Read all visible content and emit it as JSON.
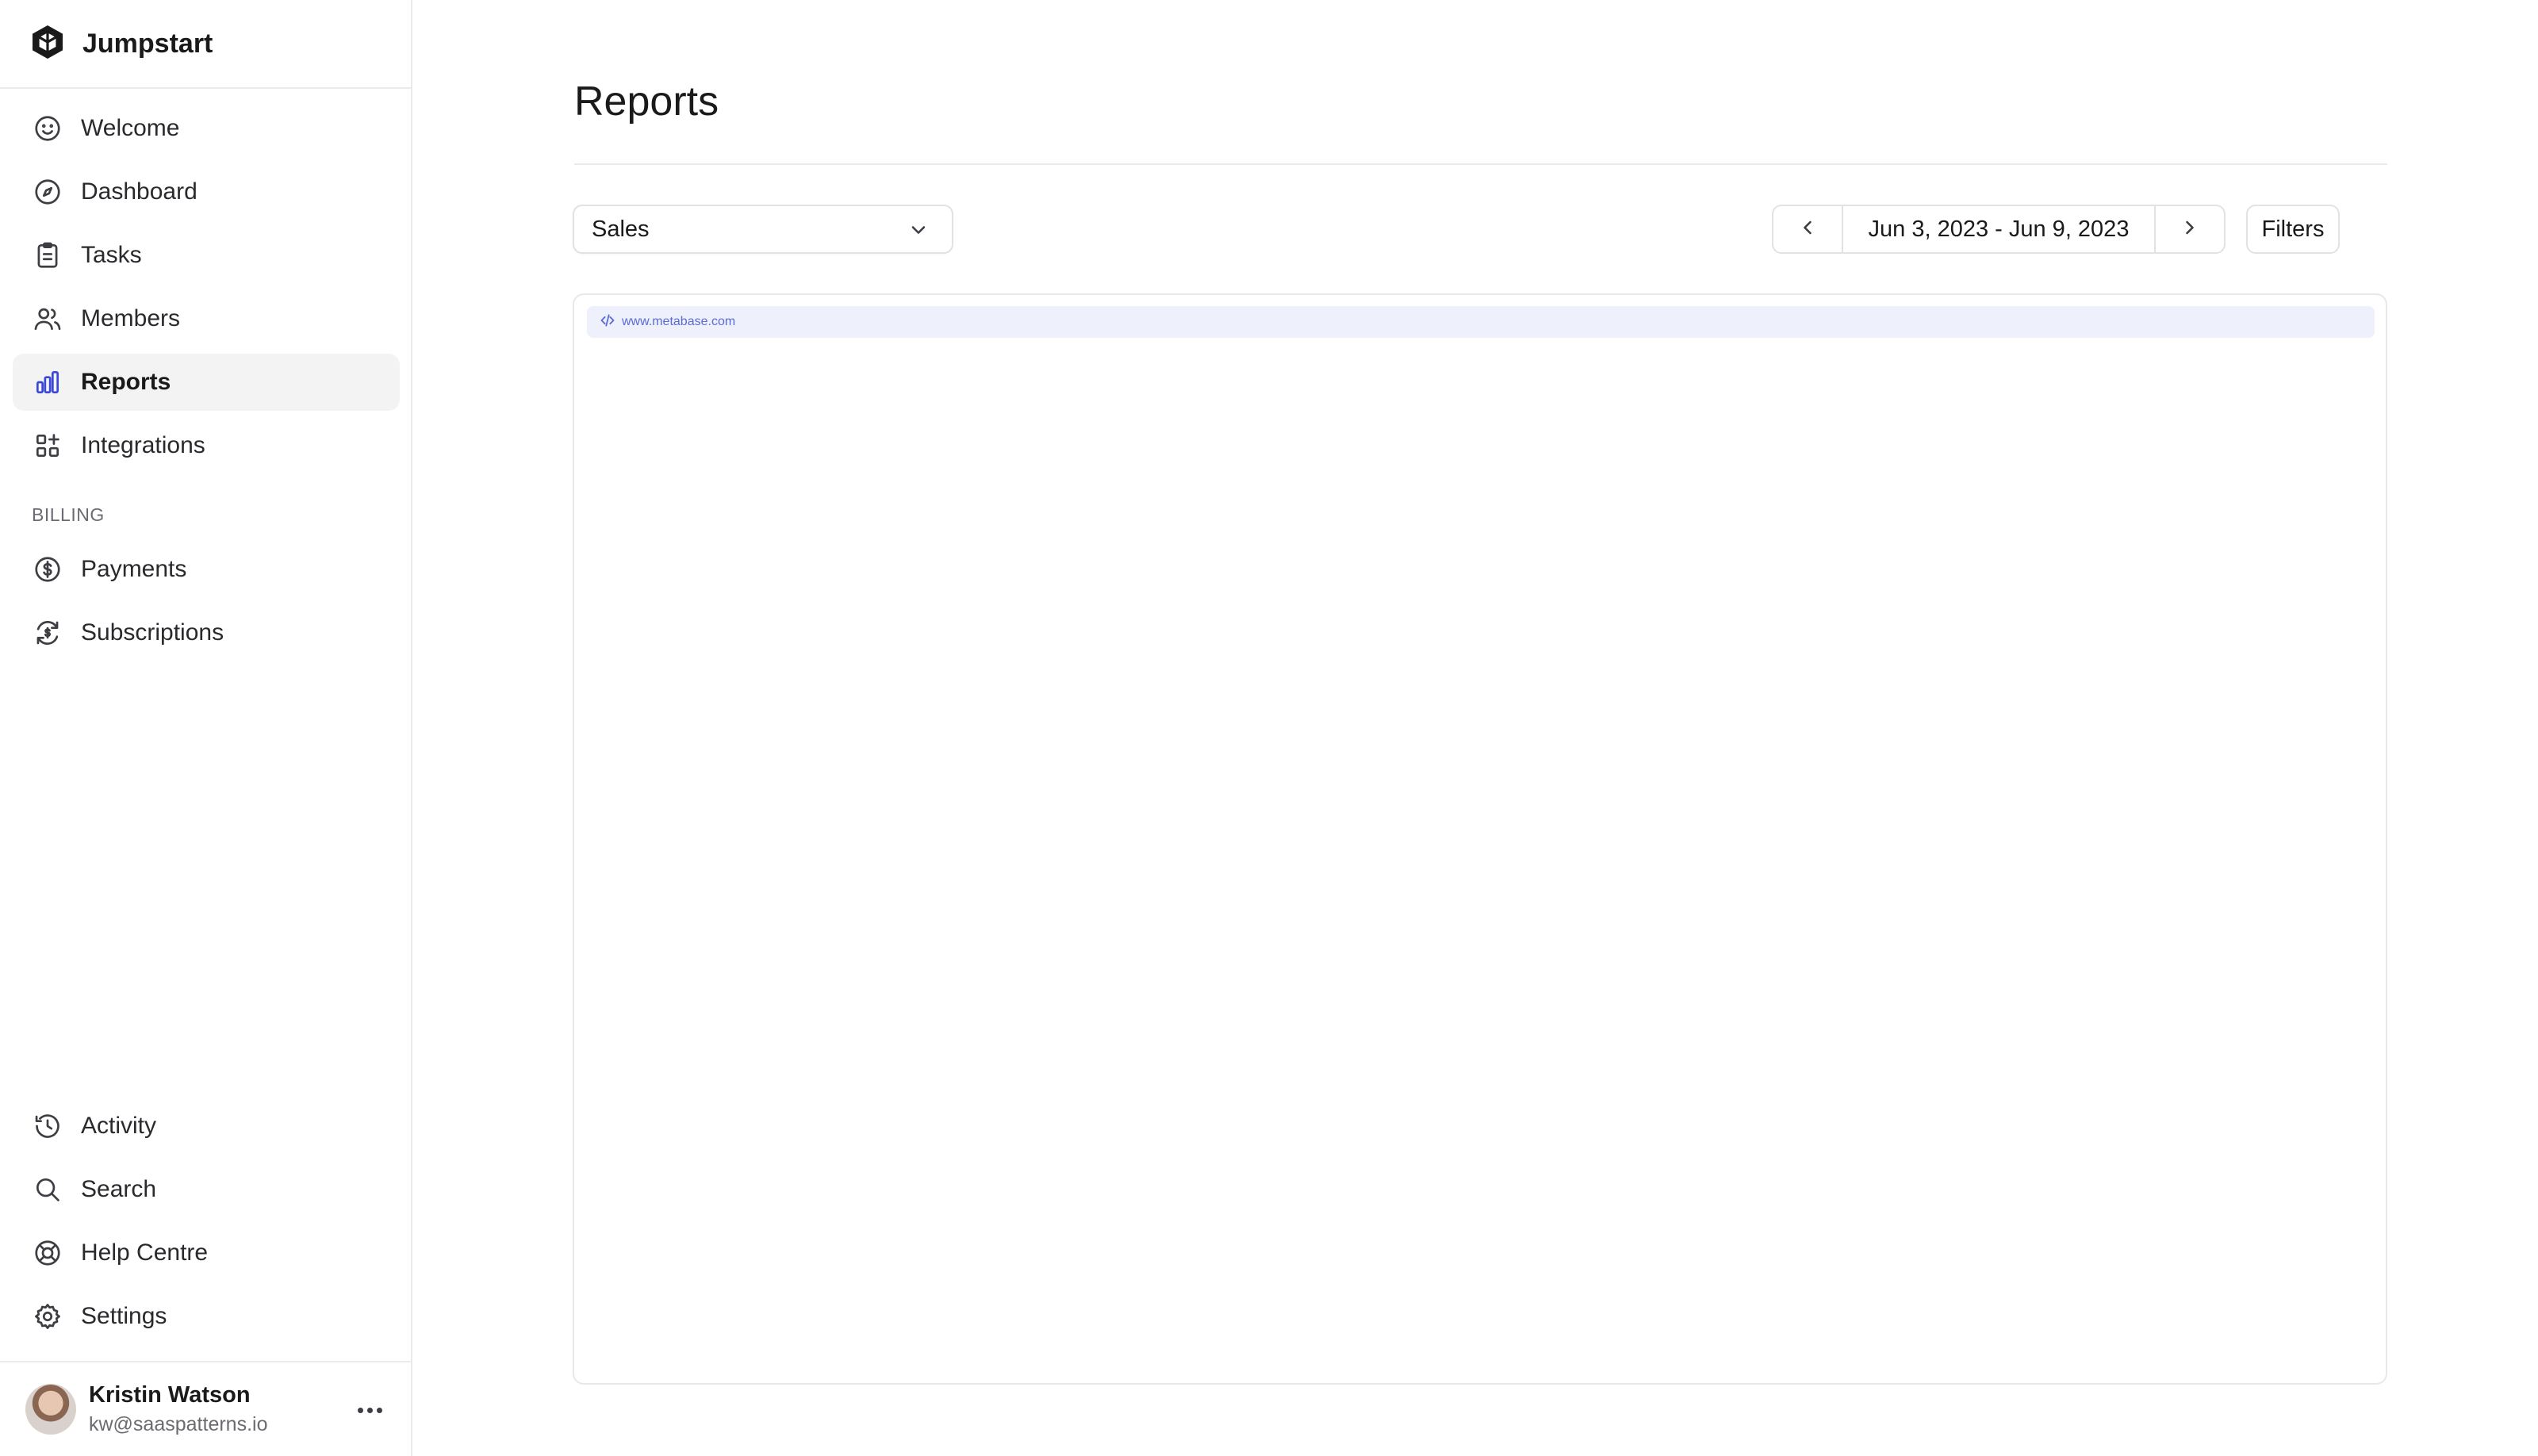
{
  "app": {
    "name": "Jumpstart"
  },
  "sidebar": {
    "items": [
      {
        "label": "Welcome",
        "icon": "smile-icon"
      },
      {
        "label": "Dashboard",
        "icon": "compass-icon"
      },
      {
        "label": "Tasks",
        "icon": "clipboard-icon"
      },
      {
        "label": "Members",
        "icon": "users-icon"
      },
      {
        "label": "Reports",
        "icon": "bar-chart-icon",
        "active": true
      },
      {
        "label": "Integrations",
        "icon": "grid-plus-icon"
      }
    ],
    "billing_title": "BILLING",
    "billing_items": [
      {
        "label": "Payments",
        "icon": "dollar-circle-icon"
      },
      {
        "label": "Subscriptions",
        "icon": "refresh-dollar-icon"
      }
    ],
    "bottom_items": [
      {
        "label": "Activity",
        "icon": "history-icon"
      },
      {
        "label": "Search",
        "icon": "search-icon"
      },
      {
        "label": "Help Centre",
        "icon": "lifebuoy-icon"
      },
      {
        "label": "Settings",
        "icon": "gear-icon"
      }
    ],
    "user": {
      "name": "Kristin Watson",
      "email": "kw@saaspatterns.io"
    }
  },
  "main": {
    "title": "Reports",
    "report_select": {
      "value": "Sales"
    },
    "date_range": {
      "label": "Jun 3, 2023 - Jun 9, 2023"
    },
    "filters_label": "Filters",
    "embed": {
      "url": "www.metabase.com"
    }
  },
  "colors": {
    "accent": "#3b48d6",
    "border": "#e2e2e5",
    "active_bg": "#f3f3f4",
    "embed_bar": "#eef1fb"
  }
}
